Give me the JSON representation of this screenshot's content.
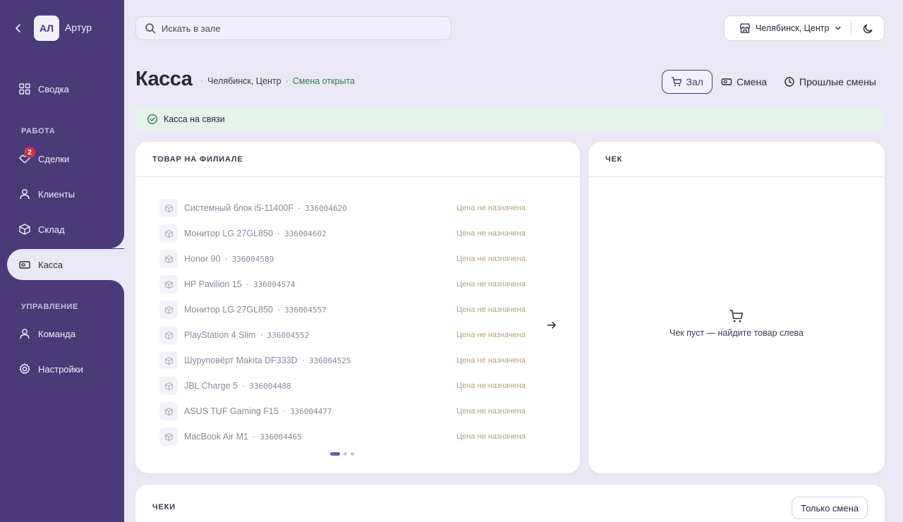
{
  "user": {
    "initials": "АЛ",
    "name": "Артур"
  },
  "nav": {
    "summary": "Сводка",
    "section_work": "РАБОТА",
    "deals": "Сделки",
    "deals_badge": "2",
    "clients": "Клиенты",
    "warehouse": "Склад",
    "cashdesk": "Касса",
    "section_manage": "УПРАВЛЕНИЕ",
    "team": "Команда",
    "settings": "Настройки"
  },
  "search": {
    "placeholder": "Искать в зале"
  },
  "branch": {
    "selected": "Челябинск, Центр"
  },
  "page": {
    "title": "Касса",
    "branch": "Челябинск, Центр",
    "shift_status": "Смена открыта",
    "sep": "·"
  },
  "tabs": {
    "hall": "Зал",
    "shift": "Смена",
    "past_shifts": "Прошлые смены"
  },
  "connection": {
    "text": "Касса на связи"
  },
  "goods": {
    "title": "ТОВАР НА ФИЛИАЛЕ",
    "items": [
      {
        "name": "Системный блок i5-11400F",
        "sku": "336004620",
        "price": "Цена не назначена"
      },
      {
        "name": "Монитор LG 27GL850",
        "sku": "336004602",
        "price": "Цена не назначена"
      },
      {
        "name": "Honor 90",
        "sku": "336004589",
        "price": "Цена не назначена"
      },
      {
        "name": "HP Pavilion 15",
        "sku": "336004574",
        "price": "Цена не назначена"
      },
      {
        "name": "Монитор LG 27GL850",
        "sku": "336004557",
        "price": "Цена не назначена"
      },
      {
        "name": "PlayStation 4 Slim",
        "sku": "336004552",
        "price": "Цена не назначена"
      },
      {
        "name": "Шуруповёрт Makita DF333D",
        "sku": "336004525",
        "price": "Цена не назначена"
      },
      {
        "name": "JBL Charge 5",
        "sku": "336004488",
        "price": "Цена не назначена"
      },
      {
        "name": "ASUS TUF Gaming F15",
        "sku": "336004477",
        "price": "Цена не назначена"
      },
      {
        "name": "MacBook Air M1",
        "sku": "336004465",
        "price": "Цена не назначена"
      }
    ],
    "pagination": {
      "pages": 3,
      "current": 1
    }
  },
  "receipt": {
    "title": "ЧЕК",
    "empty_text": "Чек пуст — найдите товар слева"
  },
  "receipts": {
    "title": "ЧЕКИ",
    "filter_label": "Только смена"
  },
  "colors": {
    "sidebar": "#4b3a78",
    "background": "#ebe8f5",
    "accent": "#4b3a78",
    "success_bg": "#e3f3ea",
    "success_text": "#2e7a52",
    "badge": "#c8364f",
    "price_muted": "#b8a272"
  },
  "icons": {
    "back": "chevron-left-icon",
    "summary": "grid-icon",
    "deals": "handshake-icon",
    "clients": "user-icon",
    "warehouse": "box-icon",
    "cashdesk": "cash-register-icon",
    "team": "user-icon",
    "settings": "gear-icon",
    "search": "search-icon",
    "branch": "store-icon",
    "theme": "moon-icon",
    "hall": "cart-icon",
    "shift": "ticket-icon",
    "past_shifts": "clock-icon",
    "connection": "check-circle-icon",
    "product": "cube-icon",
    "next": "arrow-right-icon",
    "empty_receipt": "cart-icon"
  }
}
